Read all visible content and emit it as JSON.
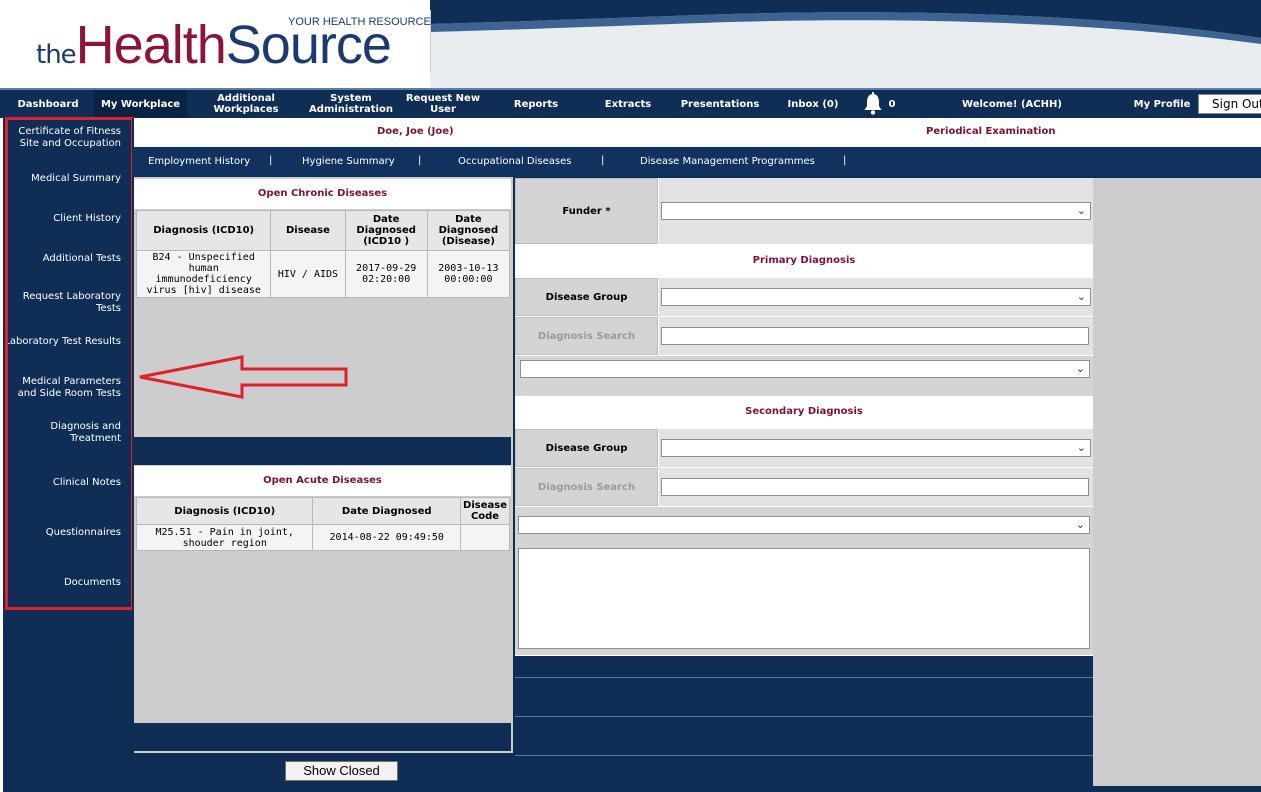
{
  "header": {
    "logo_the": "the",
    "logo_health": "Health",
    "logo_source": "Source",
    "tagline": "YOUR HEALTH RESOURCE"
  },
  "topnav": {
    "items": [
      {
        "label": "Dashboard"
      },
      {
        "label": "My Workplace"
      },
      {
        "label": "Additional Workplaces"
      },
      {
        "label": "System Administration"
      },
      {
        "label": "Request New User"
      },
      {
        "label": "Reports"
      },
      {
        "label": "Extracts"
      },
      {
        "label": "Presentations"
      },
      {
        "label": "Inbox (0)"
      }
    ],
    "bell_count": "0",
    "welcome": "Welcome! (ACHH)",
    "my_profile": "My Profile",
    "sign_out": "Sign Out"
  },
  "sidebar": {
    "items": [
      {
        "label": "Certificate of Fitness Site and Occupation"
      },
      {
        "label": "Medical Summary"
      },
      {
        "label": "Client History"
      },
      {
        "label": "Additional Tests"
      },
      {
        "label": "Request Laboratory Tests"
      },
      {
        "label": "Laboratory Test Results"
      },
      {
        "label": "Medical Parameters and Side Room Tests"
      },
      {
        "label": "Diagnosis and Treatment"
      },
      {
        "label": "Clinical Notes"
      },
      {
        "label": "Questionnaires"
      },
      {
        "label": "Documents"
      }
    ]
  },
  "patient": {
    "name": "Doe, Joe (Joe)",
    "examination": "Periodical Examination"
  },
  "subnav": {
    "items": [
      {
        "label": "Employment History"
      },
      {
        "label": "Hygiene Summary"
      },
      {
        "label": "Occupational Diseases"
      },
      {
        "label": "Disease Management Programmes"
      }
    ],
    "separator": "|"
  },
  "chronic": {
    "title": "Open Chronic Diseases",
    "headers": [
      "Diagnosis (ICD10)",
      "Disease",
      "Date Diagnosed (ICD10 )",
      "Date Diagnosed (Disease)"
    ],
    "rows": [
      {
        "diagnosis": "B24 - Unspecified human immunodeficiency virus [hiv] disease",
        "disease": "HIV / AIDS",
        "date_icd": "2017-09-29 02:20:00",
        "date_disease": "2003-10-13 00:00:00"
      }
    ]
  },
  "acute": {
    "title": "Open Acute Diseases",
    "headers": [
      "Diagnosis (ICD10)",
      "Date Diagnosed",
      "Disease Code"
    ],
    "rows": [
      {
        "diagnosis": "M25.51 - Pain in joint, shouder region",
        "date": "2014-08-22 09:49:50",
        "code": ""
      }
    ]
  },
  "buttons": {
    "show_closed": "Show Closed"
  },
  "form": {
    "funder_label": "Funder *",
    "primary_title": "Primary Diagnosis",
    "secondary_title": "Secondary Diagnosis",
    "disease_group_label": "Disease Group",
    "diagnosis_search_label": "Diagnosis Search",
    "funder_value": "",
    "primary_group_value": "",
    "primary_search_value": "",
    "primary_result_value": "",
    "secondary_group_value": "",
    "secondary_search_value": "",
    "secondary_result_value": "",
    "notes_value": ""
  },
  "colors": {
    "navy": "#0f2d55",
    "maroon": "#7a1238",
    "highlight_red": "#e0202a"
  },
  "icons": {
    "bell": "bell-icon",
    "chevron": "chevron-down-icon",
    "arrow": "left-arrow-annotation"
  }
}
